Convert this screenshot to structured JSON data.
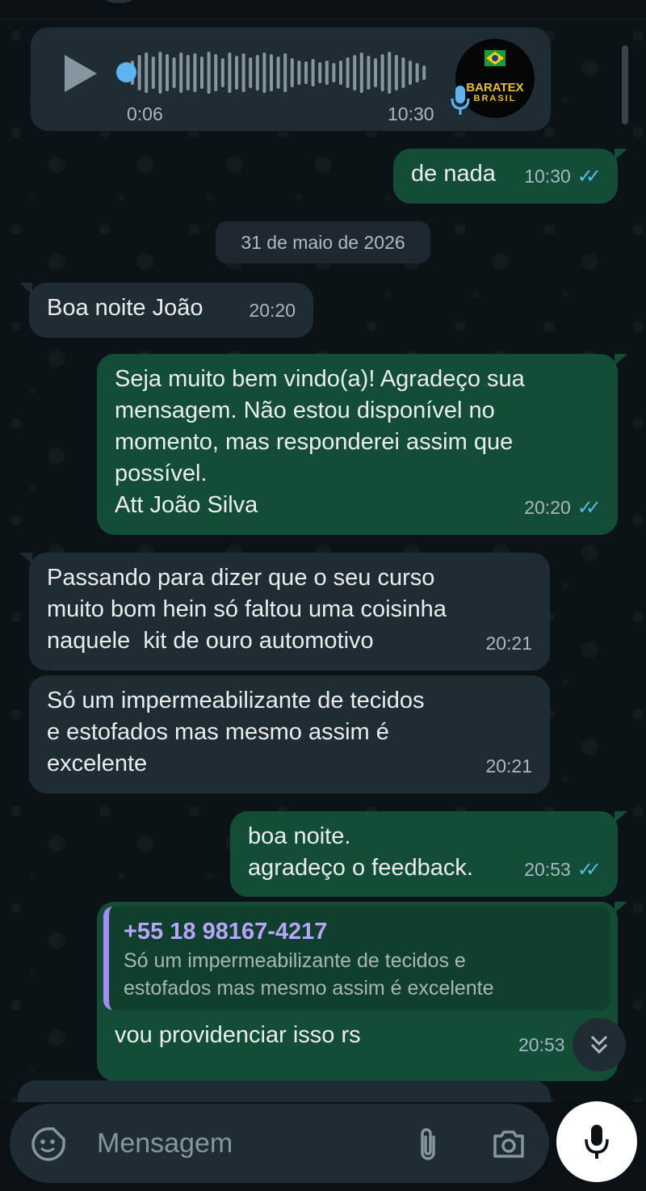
{
  "audio_message": {
    "elapsed": "0:06",
    "time": "10:30",
    "sender_avatar": "baratex-brasil-logo",
    "avatar_text_top": "BARATEX",
    "avatar_text_bottom": "BRASIL"
  },
  "date_separator": "31 de maio de 2026",
  "messages": [
    {
      "direction": "out",
      "lines": [
        "de nada"
      ],
      "time": "10:30",
      "status": "read"
    },
    {
      "direction": "in",
      "lines": [
        "Boa noite João"
      ],
      "time": "20:20"
    },
    {
      "direction": "out",
      "lines": [
        "Seja muito bem vindo(a)! Agradeço sua",
        "mensagem. Não estou disponível no",
        "momento, mas responderei assim que",
        "possível.",
        "Att João Silva"
      ],
      "time": "20:20",
      "status": "read"
    },
    {
      "direction": "in",
      "lines": [
        "Passando para dizer que o seu curso",
        "muito bom hein só faltou uma coisinha",
        "naquele  kit de ouro automotivo"
      ],
      "time": "20:21"
    },
    {
      "direction": "in",
      "lines": [
        "Só um impermeabilizante de tecidos",
        "e estofados mas mesmo assim é",
        "excelente"
      ],
      "time": "20:21"
    },
    {
      "direction": "out",
      "lines": [
        "boa noite.",
        "agradeço o feedback."
      ],
      "time": "20:53",
      "status": "read"
    },
    {
      "direction": "out",
      "quote_author": "+55 18 98167-4217",
      "quote_lines": [
        "Só um impermeabilizante de tecidos e",
        "estofados mas mesmo assim é excelente"
      ],
      "lines": [
        "vou providenciar isso rs"
      ],
      "time": "20:53"
    }
  ],
  "composer": {
    "placeholder": "Mensagem",
    "icons": [
      "sticker-icon",
      "attach-icon",
      "camera-icon",
      "mic-icon"
    ]
  },
  "colors": {
    "background": "#0b1014",
    "incoming_bubble": "#202c33",
    "outgoing_bubble": "#134d37",
    "read_ticks": "#53bdeb",
    "quote_accent": "#a38cf4",
    "audio_progress": "#5fb4ef"
  }
}
